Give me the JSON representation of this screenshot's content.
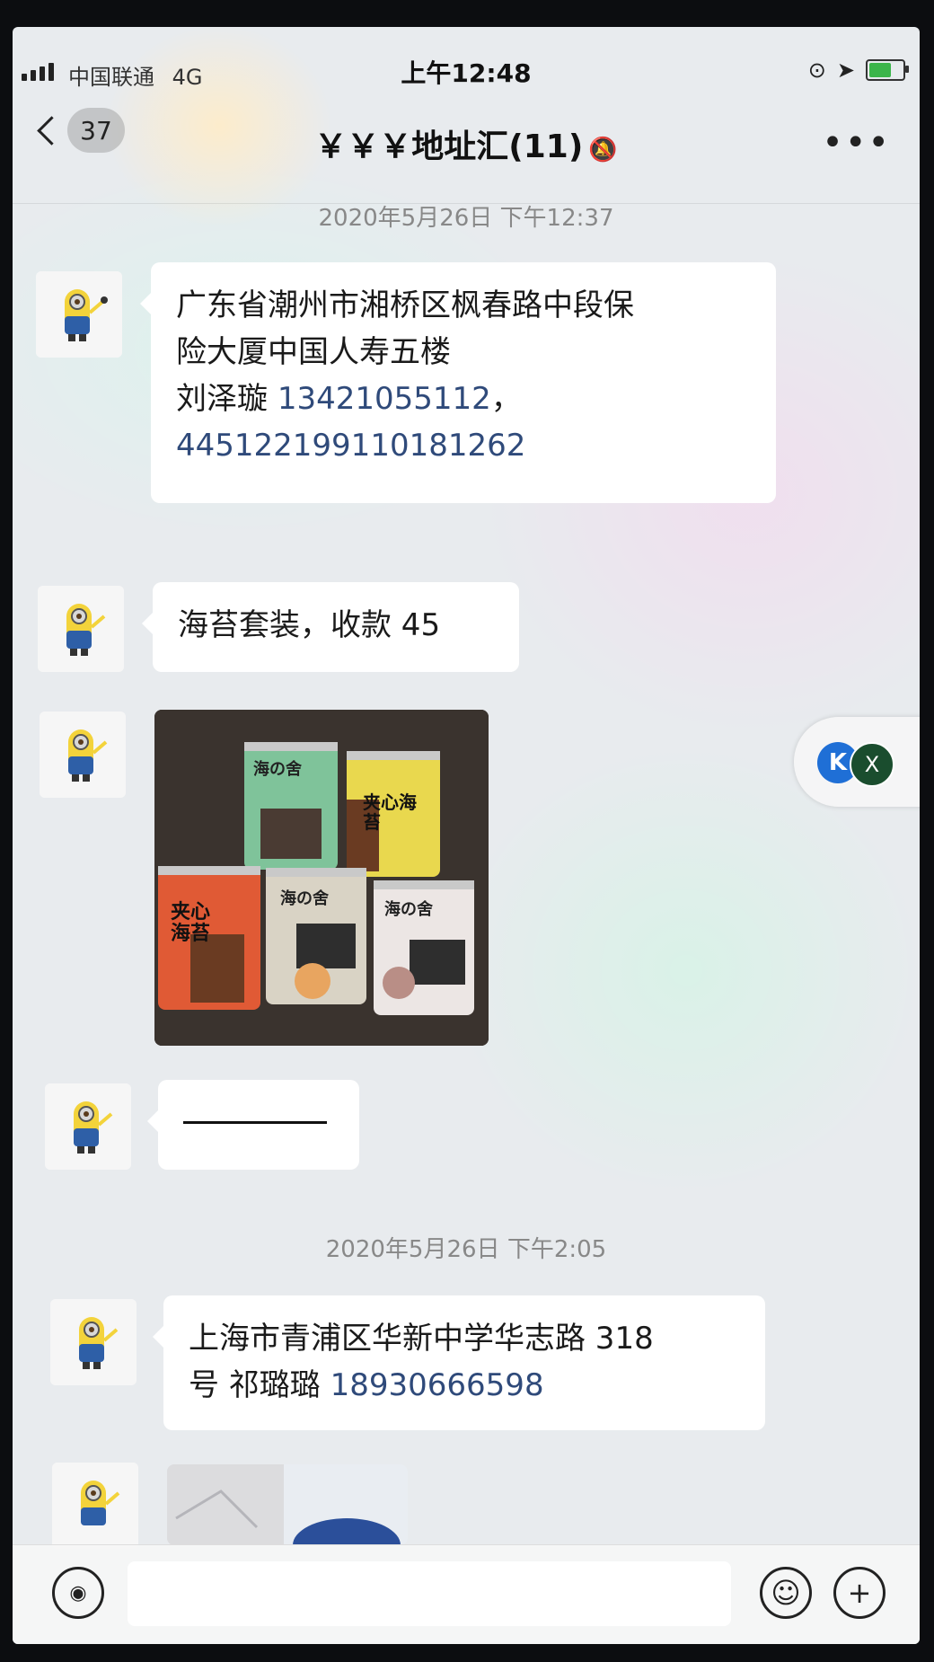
{
  "status_bar": {
    "carrier": "中国联通",
    "network": "4G",
    "time": "上午12:48"
  },
  "header": {
    "back_count": "37",
    "title": "￥￥￥地址汇(11)",
    "more": "•••"
  },
  "messages": {
    "timestamp_1": "2020年5月26日 下午12:37",
    "m1_line1": "广东省潮州市湘桥区枫春路中段保",
    "m1_line2": "险大厦中国人寿五楼",
    "m1_name": "刘泽璇",
    "m1_phone": "13421055112",
    "m1_sep": "，",
    "m1_id": "445122199110181262",
    "m2_text": "海苔套装，收款 45",
    "timestamp_2": "2020年5月26日 下午2:05",
    "m5_line1": "上海市青浦区华新中学华志路 318",
    "m5_line2_prefix": "号  祁璐璐  ",
    "m5_phone": "18930666598"
  },
  "photo": {
    "can_labels": [
      "海の舍",
      "夹心海苔",
      "夹心海苔",
      "海の舍",
      "海の舍"
    ]
  },
  "float": {
    "k_label": "K",
    "x_label": "X"
  },
  "input_bar": {
    "emoji_label": "☺",
    "plus_label": "+"
  }
}
